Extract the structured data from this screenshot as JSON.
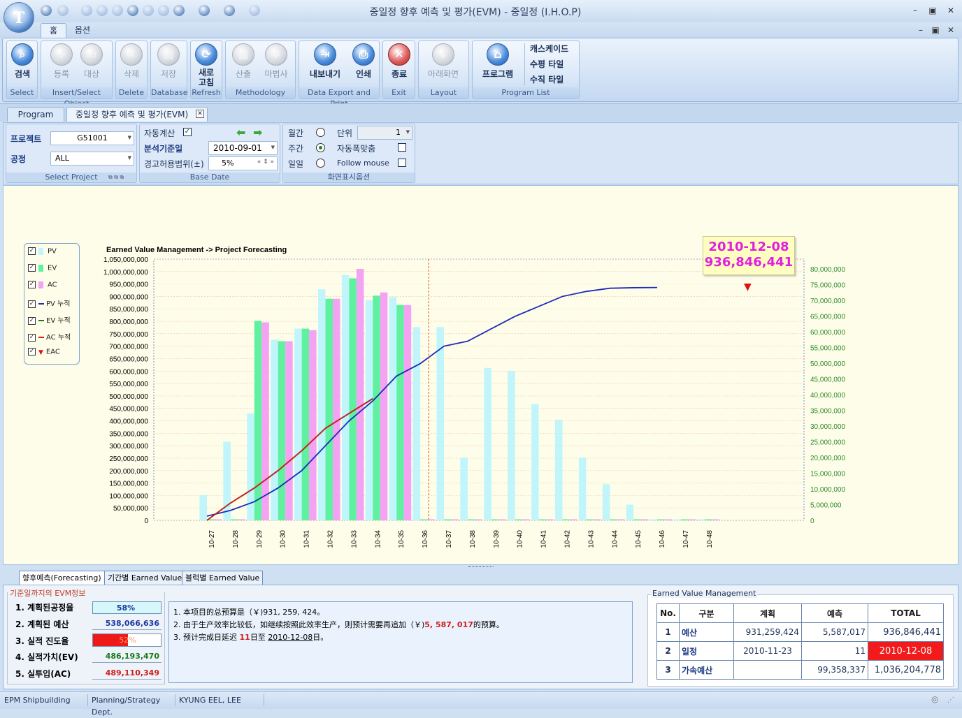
{
  "window": {
    "title": "중일정 향후 예측 및 평가(EVM) - 중일정 (I.H.O.P)",
    "logo_letter": "T"
  },
  "ribbon_tabs": [
    "홈",
    "옵션"
  ],
  "ribbon": {
    "groups": [
      "Select",
      "Insert/Select Object",
      "Delete",
      "Database",
      "Refresh",
      "Methodology",
      "Data Export and Print",
      "Exit",
      "Layout",
      "Program List"
    ],
    "buttons": {
      "search": "검색",
      "register": "등록",
      "target": "대상",
      "delete": "삭제",
      "save": "저장",
      "refresh1": "새로",
      "refresh2": "고침",
      "calc": "산출",
      "wizard": "마법사",
      "export": "내보내기",
      "print": "인쇄",
      "exit": "종료",
      "below_screen": "아래화면",
      "program": "프로그램"
    },
    "window_links": [
      "캐스케이드",
      "수평 타일",
      "수직 타일"
    ]
  },
  "doc_tabs": [
    "Program",
    "중일정 향후 예측 및 평가(EVM)"
  ],
  "filters": {
    "project_label": "프로젝트",
    "project_value": "G51001",
    "process_label": "공정",
    "process_value": "ALL",
    "group_select": "Select Project",
    "autocalc_label": "자동계산",
    "base_date_label": "분석기준일",
    "base_date_value": "2010-09-01",
    "tolerance_label": "경고허용범위(±)",
    "tolerance_value": "5%",
    "group_base": "Base Date",
    "monthly": "월간",
    "weekly": "주간",
    "daily": "일일",
    "unit_label": "단위",
    "unit_value": "1",
    "autofit_label": "자동폭맞춤",
    "follow_label": "Follow mouse",
    "group_display": "화면표시옵션"
  },
  "legend": [
    "PV",
    "EV",
    "AC",
    "PV 누적",
    "EV 누적",
    "AC 누적",
    "EAC"
  ],
  "eac_box": {
    "date": "2010-12-08",
    "value": "936,846,441"
  },
  "chart_data": {
    "type": "bar",
    "title": "Earned Value Management -> Project Forecasting",
    "categories": [
      "10-27",
      "10-28",
      "10-29",
      "10-30",
      "10-31",
      "10-32",
      "10-33",
      "10-34",
      "10-35",
      "10-36",
      "10-37",
      "10-38",
      "10-39",
      "10-40",
      "10-41",
      "10-42",
      "10-43",
      "10-44",
      "10-45",
      "10-46",
      "10-47",
      "10-48"
    ],
    "y_left": {
      "min": 0,
      "max": 1050000000,
      "step": 50000000
    },
    "y_right": {
      "min": 0,
      "max": 80000000,
      "step": 5000000
    },
    "series": [
      {
        "name": "PV",
        "axis": "right",
        "color": "#bff5fb",
        "values": [
          8000000,
          25000000,
          34000000,
          57500000,
          61000000,
          73500000,
          78000000,
          70000000,
          71000000,
          61500000,
          61500000,
          20000000,
          48500000,
          47500000,
          37000000,
          32000000,
          20000000,
          11500000,
          5000000,
          0,
          0,
          0
        ]
      },
      {
        "name": "EV",
        "axis": "right",
        "color": "#5ff1a0",
        "values": [
          0,
          0,
          63500000,
          57000000,
          61000000,
          70500000,
          77000000,
          71500000,
          68500000,
          0,
          0,
          0,
          0,
          0,
          0,
          0,
          0,
          0,
          0,
          0,
          0,
          0
        ]
      },
      {
        "name": "AC",
        "axis": "right",
        "color": "#f4a2f3",
        "values": [
          0,
          0,
          63000000,
          57000000,
          60500000,
          70500000,
          80000000,
          72500000,
          68500000,
          0,
          0,
          0,
          0,
          0,
          0,
          0,
          0,
          0,
          0,
          0,
          0,
          0
        ]
      },
      {
        "name": "PV 누적",
        "axis": "left",
        "type": "line",
        "color": "#1c2cb8",
        "values": [
          17000000,
          40000000,
          75000000,
          130000000,
          200000000,
          300000000,
          400000000,
          480000000,
          580000000,
          630000000,
          700000000,
          720000000,
          770000000,
          820000000,
          860000000,
          900000000,
          920000000,
          933000000,
          935000000,
          936000000
        ]
      },
      {
        "name": "EV 누적",
        "axis": "left",
        "type": "line",
        "color": "#1b7c1b",
        "values": [
          0,
          70000000,
          130000000,
          200000000,
          280000000,
          370000000,
          430000000,
          490000000
        ]
      },
      {
        "name": "AC 누적",
        "axis": "left",
        "type": "line",
        "color": "#d01c1c",
        "values": [
          0,
          70000000,
          130000000,
          200000000,
          280000000,
          370000000,
          430000000,
          489000000
        ]
      }
    ],
    "status_line_index": 9
  },
  "bottom_tabs": [
    "향후예측(Forecasting)",
    "기간별 Earned Value",
    "블럭별 Earned Value"
  ],
  "evm_info": {
    "title": "기준일까지의 EVM정보",
    "rows": [
      {
        "label": "1. 계획된공정율",
        "value": "58%"
      },
      {
        "label": "2. 계획된 예산",
        "value": "538,066,636"
      },
      {
        "label": "3. 실적 진도율",
        "value": "52%"
      },
      {
        "label": "4. 실적가치(EV)",
        "value": "486,193,470"
      },
      {
        "label": "5. 실투입(AC)",
        "value": "489,110,349"
      }
    ]
  },
  "message": {
    "line1": "1. 本项目的总预算是（￥)931, 259, 424。",
    "line2a": "2. 由于生产效率比较低，如继续按照此效率生产，则预计需要再追加（￥)",
    "line2b": "5, 587, 017",
    "line2c": "的预算。",
    "line3a": "3. 预计完成日延迟 ",
    "line3b": "11",
    "line3c": "日至 ",
    "line3d": "2010-12-08",
    "line3e": "日。"
  },
  "evm_table": {
    "title": "Earned Value Management",
    "headers": [
      "No.",
      "구분",
      "계획",
      "예측",
      "TOTAL"
    ],
    "rows": [
      [
        "1",
        "예산",
        "931,259,424",
        "5,587,017",
        "936,846,441"
      ],
      [
        "2",
        "일정",
        "2010-11-23",
        "11",
        "2010-12-08"
      ],
      [
        "3",
        "가속예산",
        "",
        "99,358,337",
        "1,036,204,778"
      ]
    ]
  },
  "status": [
    "EPM Shipbuilding",
    "Planning/Strategy Dept.",
    "KYUNG EEL, LEE"
  ]
}
